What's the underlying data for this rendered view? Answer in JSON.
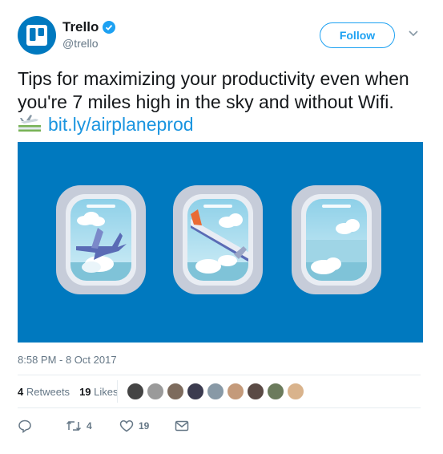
{
  "account": {
    "name": "Trello",
    "handle": "@trello"
  },
  "follow_label": "Follow",
  "tweet": {
    "text": "Tips for maximizing your productivity even when you're 7 miles high in the sky and without Wifi. ",
    "link": "bit.ly/airplaneprod"
  },
  "timestamp": "8:58 PM - 8 Oct 2017",
  "stats": {
    "retweets_count": "4",
    "retweets_label": "Retweets",
    "likes_count": "19",
    "likes_label": "Likes"
  },
  "liker_colors": [
    "#444",
    "#9a9a9a",
    "#7d6b5d",
    "#3b3b4f",
    "#8899a6",
    "#c49a7a",
    "#5a4a45",
    "#6b7b5c",
    "#d9b38c"
  ],
  "actions": {
    "retweet_count": "4",
    "like_count": "19"
  },
  "colors": {
    "brand": "#0079bf",
    "accent": "#1da1f2"
  },
  "icons": [
    "trello-logo-icon",
    "verified-badge-icon",
    "chevron-down-icon",
    "airplane-emoji-icon",
    "reply-icon",
    "retweet-icon",
    "like-icon",
    "message-icon"
  ]
}
